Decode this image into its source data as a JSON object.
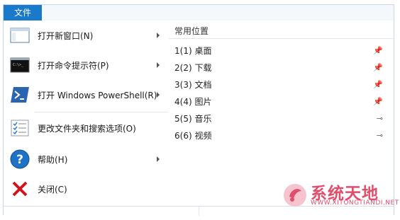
{
  "file_tab": {
    "label": "文件"
  },
  "menu": {
    "items": [
      {
        "name": "new-window",
        "label": "打开新窗口(N)",
        "has_submenu": true
      },
      {
        "name": "cmd",
        "label": "打开命令提示符(P)",
        "has_submenu": true
      },
      {
        "name": "powershell",
        "label": "打开 Windows PowerShell(R)",
        "has_submenu": true
      },
      {
        "name": "folder-options",
        "label": "更改文件夹和搜索选项(O)",
        "has_submenu": false
      },
      {
        "name": "help",
        "label": "帮助(H)",
        "has_submenu": true
      },
      {
        "name": "close",
        "label": "关闭(C)",
        "has_submenu": false
      }
    ]
  },
  "frequent": {
    "title": "常用位置",
    "items": [
      {
        "label": "1(1)  桌面",
        "pin": "pinned"
      },
      {
        "label": "2(2)  下载",
        "pin": "pinned"
      },
      {
        "label": "3(3)  文档",
        "pin": "pinned"
      },
      {
        "label": "4(4)  图片",
        "pin": "pinned"
      },
      {
        "label": "5(5)  音乐",
        "pin": "unpinned"
      },
      {
        "label": "6(6)  视频",
        "pin": "unpinned"
      }
    ]
  },
  "watermark": {
    "name": "系统天地",
    "url": "WWW.XITONGTIANDI.NET"
  },
  "colors": {
    "accent": "#1979ca",
    "watermark": "#e24d6b",
    "close_x": "#d1131d"
  }
}
